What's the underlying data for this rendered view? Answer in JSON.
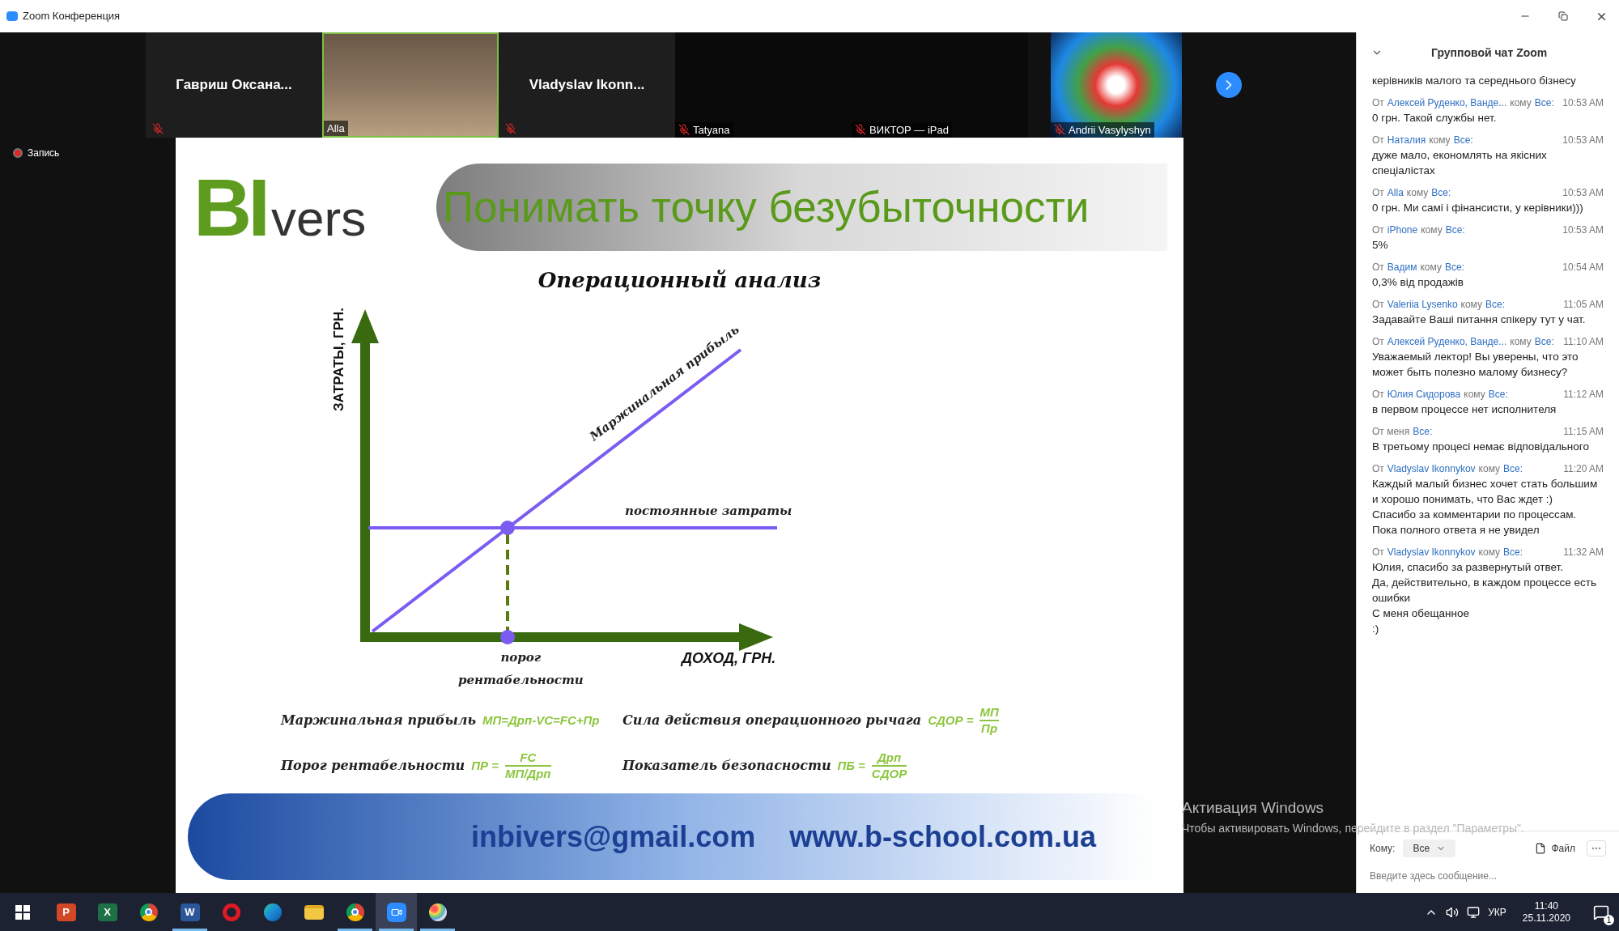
{
  "window": {
    "title": "Zoom Конференция"
  },
  "participants": [
    {
      "kind": "name",
      "name": "Гавриш Оксана...",
      "muted": true
    },
    {
      "kind": "video",
      "name": "Alla",
      "muted": false
    },
    {
      "kind": "name",
      "name": "Vladyslav Ikonn...",
      "muted": true
    },
    {
      "kind": "blank",
      "name": "Tatyana",
      "muted": true
    },
    {
      "kind": "blank",
      "name": "ВИКТОР — iPad",
      "muted": true
    },
    {
      "kind": "avatar",
      "name": "Andrii Vasylyshyn",
      "muted": true
    }
  ],
  "recording": {
    "label": "Запись"
  },
  "slide": {
    "logo": {
      "letters": "BI",
      "suffix": "vers"
    },
    "title": "Понимать точку безубыточности",
    "subtitle": "Операционный анализ",
    "diagram": {
      "y_axis": "ЗАТРАТЫ, ГРН.",
      "x_axis": "ДОХОД, ГРН.",
      "line_label": "Маржинальная прибыль",
      "fixed_label": "постоянные затраты",
      "threshold_label": "порог рентабельности"
    },
    "formulas": [
      {
        "kind": "inline",
        "label": "Маржинальная прибыль",
        "expr": "МП=Дрп-VC=FC+Пр"
      },
      {
        "kind": "fraction",
        "label": "Сила действия операционного рычага",
        "expr": "СДОР =",
        "numerator": "МП",
        "denominator": "Пр"
      },
      {
        "kind": "fraction",
        "label": "Порог рентабельности",
        "expr": "ПР =",
        "numerator": "FC",
        "denominator": "МП/Дрп"
      },
      {
        "kind": "fraction",
        "label": "Показатель безопасности",
        "expr": "ПБ =",
        "numerator": "Дрп",
        "denominator": "СДОР"
      }
    ],
    "contacts": [
      "inbivers@gmail.com",
      "www.b-school.com.ua"
    ]
  },
  "chat": {
    "title": "Групповой чат Zoom",
    "messages": [
      {
        "lines": [
          "керівників малого та середнього бізнесу"
        ]
      },
      {
        "header": [
          {
            "text": "От",
            "highlight": false
          },
          {
            "text": "Алексей Руденко, Ванде...",
            "highlight": true
          },
          {
            "text": "кому",
            "highlight": false
          },
          {
            "text": "Все:",
            "highlight": true
          }
        ],
        "time": "10:53 AM",
        "lines": [
          "0 грн. Такой службы нет."
        ]
      },
      {
        "header": [
          {
            "text": "От",
            "highlight": false
          },
          {
            "text": "Наталия",
            "highlight": true
          },
          {
            "text": "кому",
            "highlight": false
          },
          {
            "text": "Все:",
            "highlight": true
          }
        ],
        "time": "10:53 AM",
        "lines": [
          "дуже мало, економлять на якісних спеціалістах"
        ]
      },
      {
        "header": [
          {
            "text": "От",
            "highlight": false
          },
          {
            "text": "Alla",
            "highlight": true
          },
          {
            "text": "кому",
            "highlight": false
          },
          {
            "text": "Все:",
            "highlight": true
          }
        ],
        "time": "10:53 AM",
        "lines": [
          "0 грн. Ми самі і фінансисти, у керівники)))"
        ]
      },
      {
        "header": [
          {
            "text": "От",
            "highlight": false
          },
          {
            "text": "iPhone",
            "highlight": true
          },
          {
            "text": "кому",
            "highlight": false
          },
          {
            "text": "Все:",
            "highlight": true
          }
        ],
        "time": "10:53 AM",
        "lines": [
          "5%"
        ]
      },
      {
        "header": [
          {
            "text": "От",
            "highlight": false
          },
          {
            "text": "Вадим",
            "highlight": true
          },
          {
            "text": "кому",
            "highlight": false
          },
          {
            "text": "Все:",
            "highlight": true
          }
        ],
        "time": "10:54 AM",
        "lines": [
          "0,3% від продажів"
        ]
      },
      {
        "header": [
          {
            "text": "От",
            "highlight": false
          },
          {
            "text": "Valeriia Lysenko",
            "highlight": true
          },
          {
            "text": "кому",
            "highlight": false
          },
          {
            "text": "Все:",
            "highlight": true
          }
        ],
        "time": "11:05 AM",
        "lines": [
          "Задавайте Ваші питання спікеру тут у чат."
        ]
      },
      {
        "header": [
          {
            "text": "От",
            "highlight": false
          },
          {
            "text": "Алексей Руденко, Ванде...",
            "highlight": true
          },
          {
            "text": "кому",
            "highlight": false
          },
          {
            "text": "Все:",
            "highlight": true
          }
        ],
        "time": "11:10 AM",
        "lines": [
          "Уважаемый лектор! Вы уверены, что это может быть полезно малому бизнесу?"
        ]
      },
      {
        "header": [
          {
            "text": "От",
            "highlight": false
          },
          {
            "text": "Юлия Сидорова",
            "highlight": true
          },
          {
            "text": "кому",
            "highlight": false
          },
          {
            "text": "Все:",
            "highlight": true
          }
        ],
        "time": "11:12 AM",
        "lines": [
          "в первом процессе нет исполнителя"
        ]
      },
      {
        "header": [
          {
            "text": "От меня",
            "highlight": false
          },
          {
            "text": "Все:",
            "highlight": true
          }
        ],
        "time": "11:15 AM",
        "lines": [
          "В третьому процесі немає відповідального"
        ]
      },
      {
        "header": [
          {
            "text": "От",
            "highlight": false
          },
          {
            "text": "Vladyslav Ikonnykov",
            "highlight": true
          },
          {
            "text": "кому",
            "highlight": false
          },
          {
            "text": "Все:",
            "highlight": true
          }
        ],
        "time": "11:20 AM",
        "lines": [
          "Каждый малый бизнес хочет стать большим и хорошо понимать, что Вас ждет :)",
          "Спасибо за комментарии по процессам. Пока полного ответа я не увидел"
        ]
      },
      {
        "header": [
          {
            "text": "От",
            "highlight": false
          },
          {
            "text": "Vladyslav Ikonnykov",
            "highlight": true
          },
          {
            "text": "кому",
            "highlight": false
          },
          {
            "text": "Все:",
            "highlight": true
          }
        ],
        "time": "11:32 AM",
        "lines": [
          "Юлия, спасибо за развернутый ответ.",
          "Да, действительно, в каждом процессе есть ошибки",
          "С меня обещанное",
          ":)"
        ]
      }
    ],
    "to_label": "Кому:",
    "to_value": "Все",
    "file_label": "Файл",
    "placeholder": "Введите здесь сообщение..."
  },
  "watermark": {
    "title": "Активация Windows",
    "text": "Чтобы активировать Windows, перейдите в раздел \"Параметры\"."
  },
  "taskbar": {
    "apps": [
      {
        "kind": "powerpoint",
        "glyph": "P",
        "open": false,
        "selected": false
      },
      {
        "kind": "excel",
        "glyph": "X",
        "open": false,
        "selected": false
      },
      {
        "kind": "chrome",
        "open": false,
        "selected": false
      },
      {
        "kind": "word",
        "glyph": "W",
        "open": true,
        "selected": false
      },
      {
        "kind": "opera",
        "open": false,
        "selected": false
      },
      {
        "kind": "edge",
        "open": false,
        "selected": false
      },
      {
        "kind": "explorer",
        "open": false,
        "selected": false
      },
      {
        "kind": "chrome",
        "open": true,
        "selected": false
      },
      {
        "kind": "zoom",
        "open": true,
        "selected": true
      },
      {
        "kind": "paint",
        "open": true,
        "selected": false
      }
    ],
    "language": "УКР",
    "time": "11:40",
    "date": "25.11.2020",
    "notifications": "1"
  }
}
